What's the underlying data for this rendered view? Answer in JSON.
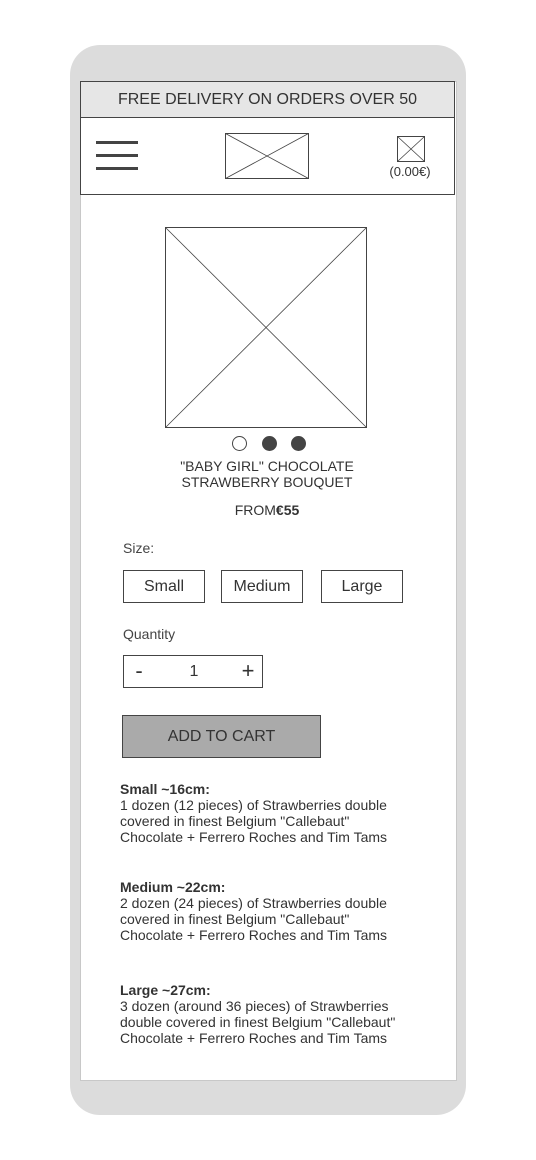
{
  "banner": {
    "text": "FREE DELIVERY ON ORDERS OVER 50"
  },
  "header": {
    "menu_icon": "hamburger-menu-icon",
    "logo_icon": "image-placeholder-icon",
    "cart_icon": "image-placeholder-icon",
    "cart_total": "(0.00€)"
  },
  "product": {
    "image_icon": "image-placeholder-icon",
    "carousel": {
      "slides": 3,
      "active_index": 0
    },
    "title_line1": "\"BABY GIRL\" CHOCOLATE",
    "title_line2": "STRAWBERRY BOUQUET",
    "price_prefix": "FROM",
    "price_value": "€55"
  },
  "size": {
    "label": "Size:",
    "options": [
      "Small",
      "Medium",
      "Large"
    ]
  },
  "quantity": {
    "label": "Quantity",
    "minus": "-",
    "value": "1",
    "plus": "+"
  },
  "add_to_cart": {
    "label": "ADD TO CART"
  },
  "descriptions": [
    {
      "heading": "Small ~16cm:",
      "lines": [
        "1 dozen (12 pieces) of Strawberries double",
        "covered in finest Belgium \"Callebaut\"",
        "Chocolate + Ferrero Roches and Tim Tams"
      ]
    },
    {
      "heading": "Medium ~22cm:",
      "lines": [
        "2 dozen (24 pieces) of Strawberries double",
        "covered in finest Belgium \"Callebaut\"",
        "Chocolate + Ferrero Roches and Tim Tams"
      ]
    },
    {
      "heading": "Large ~27cm:",
      "lines": [
        "3 dozen (around 36 pieces) of Strawberries",
        "double covered in finest Belgium \"Callebaut\"",
        "Chocolate + Ferrero Roches and Tim Tams"
      ]
    }
  ],
  "colors": {
    "frame": "#dcdcdc",
    "stroke": "#444444",
    "banner_bg": "#e6e6e6",
    "button_bg": "#aaaaaa"
  }
}
